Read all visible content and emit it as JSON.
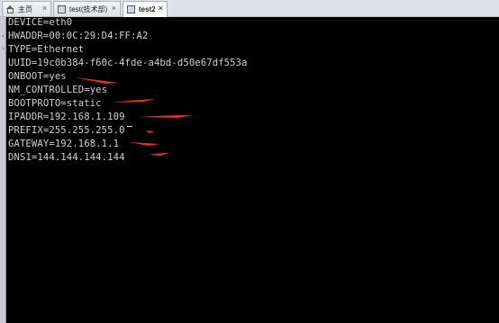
{
  "tabs": [
    {
      "label": "主页",
      "icon": "home-icon",
      "active": false
    },
    {
      "label": "test(技术部)",
      "icon": "vm-icon",
      "active": false
    },
    {
      "label": "test2",
      "icon": "vm-icon",
      "active": true
    }
  ],
  "close_glyph": "×",
  "terminal": {
    "lines": [
      "DEVICE=eth0",
      "HWADDR=00:0C:29:D4:FF:A2",
      "TYPE=Ethernet",
      "UUID=19c0b384-f60c-4fde-a4bd-d50e67df553a",
      "ONBOOT=yes",
      "NM_CONTROLLED=yes",
      "BOOTPROTO=static",
      "IPADDR=192.168.1.109",
      "PREFIX=255.255.255.0",
      "GATEWAY=192.168.1.1",
      "DNS1=144.144.144.144"
    ],
    "text_color": "#d0d0d0",
    "background": "#000000"
  },
  "annotation": {
    "color": "#e8302a",
    "marked_lines": [
      "ONBOOT=yes",
      "BOOTPROTO=static",
      "IPADDR=192.168.1.109",
      "PREFIX=255.255.255.0",
      "GATEWAY=192.168.1.1",
      "DNS1=144.144.144.144"
    ]
  }
}
